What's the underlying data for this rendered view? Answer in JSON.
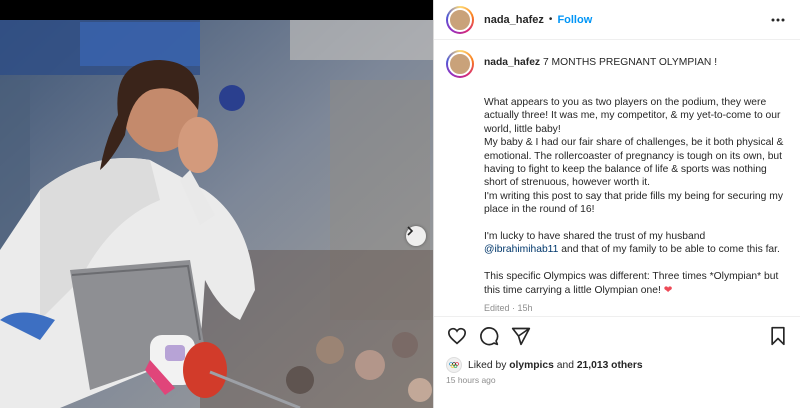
{
  "header": {
    "username": "nada_hafez",
    "separator": "•",
    "follow_label": "Follow",
    "more_icon": "more-horizontal-icon"
  },
  "caption": {
    "username": "nada_hafez",
    "title": "7 MONTHS PREGNANT OLYMPIAN !",
    "p1": "What appears to you as two players on the podium, they were actually three! It was me, my competitor, & my yet-to-come to our world, little baby!",
    "p2": "My baby & I had our fair share of challenges, be it both physical & emotional. The rollercoaster of pregnancy is tough on its own, but having to fight to keep the balance of life & sports was nothing short of strenuous, however worth it.",
    "p3": "I'm writing this post to say that pride fills my being for securing my place in the round of 16!",
    "p4_before": "I'm lucky to have shared the trust of my husband",
    "p4_mention": "@ibrahimihab11",
    "p4_after": "and that of my family to be able to come this far.",
    "p5": "This specific Olympics was different: Three times *Olympian* but this time carrying a little Olympian one!",
    "p5_emoji": "❤",
    "edited": "Edited · 15h"
  },
  "likes": {
    "prefix": "Liked by",
    "user": "olympics",
    "and": "and",
    "others": "21,013 others"
  },
  "time_ago": "15 hours ago",
  "colors": {
    "accent": "#0095f6",
    "mention": "#00376b",
    "heart": "#ed4956"
  }
}
